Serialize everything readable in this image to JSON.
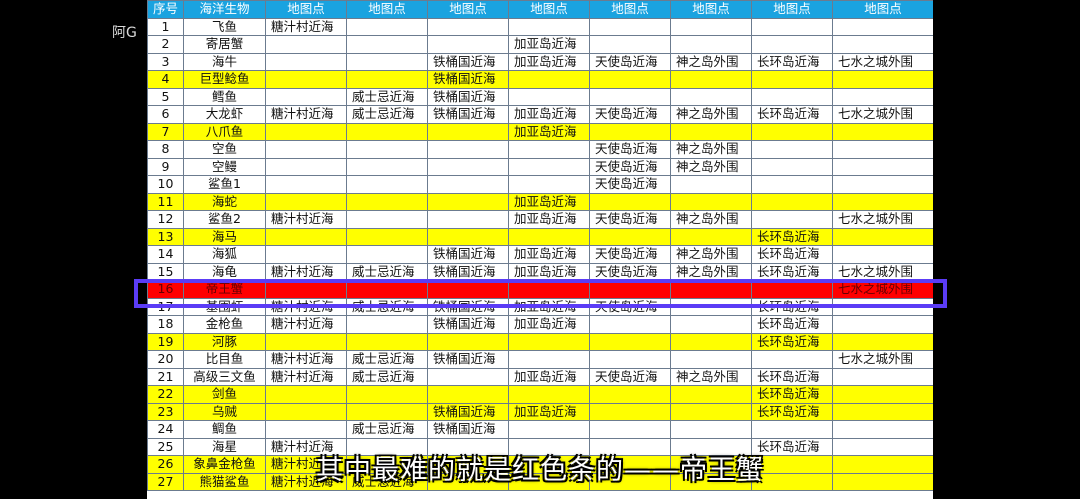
{
  "watermark": "阿G",
  "subtitle": "其中最难的就是红色条的——帝王蟹",
  "headers": [
    "序号",
    "海洋生物",
    "地图点",
    "地图点",
    "地图点",
    "地图点",
    "地图点",
    "地图点",
    "地图点",
    "地图点"
  ],
  "rows": [
    {
      "style": "white",
      "cells": [
        "1",
        "飞鱼",
        "糖汁村近海",
        "",
        "",
        "",
        "",
        "",
        "",
        ""
      ]
    },
    {
      "style": "white",
      "cells": [
        "2",
        "寄居蟹",
        "",
        "",
        "",
        "加亚岛近海",
        "",
        "",
        "",
        ""
      ]
    },
    {
      "style": "white",
      "cells": [
        "3",
        "海牛",
        "",
        "",
        "铁桶国近海",
        "加亚岛近海",
        "天使岛近海",
        "神之岛外围",
        "长环岛近海",
        "七水之城外围"
      ]
    },
    {
      "style": "yellow",
      "cells": [
        "4",
        "巨型鲶鱼",
        "",
        "",
        "铁桶国近海",
        "",
        "",
        "",
        "",
        ""
      ]
    },
    {
      "style": "white",
      "cells": [
        "5",
        "鳕鱼",
        "",
        "威士忌近海",
        "铁桶国近海",
        "",
        "",
        "",
        "",
        ""
      ]
    },
    {
      "style": "white",
      "cells": [
        "6",
        "大龙虾",
        "糖汁村近海",
        "威士忌近海",
        "铁桶国近海",
        "加亚岛近海",
        "天使岛近海",
        "神之岛外围",
        "长环岛近海",
        "七水之城外围"
      ]
    },
    {
      "style": "yellow",
      "cells": [
        "7",
        "八爪鱼",
        "",
        "",
        "",
        "加亚岛近海",
        "",
        "",
        "",
        ""
      ]
    },
    {
      "style": "white",
      "cells": [
        "8",
        "空鱼",
        "",
        "",
        "",
        "",
        "天使岛近海",
        "神之岛外围",
        "",
        ""
      ]
    },
    {
      "style": "white",
      "cells": [
        "9",
        "空鳗",
        "",
        "",
        "",
        "",
        "天使岛近海",
        "神之岛外围",
        "",
        ""
      ]
    },
    {
      "style": "white",
      "cells": [
        "10",
        "鲨鱼1",
        "",
        "",
        "",
        "",
        "天使岛近海",
        "",
        "",
        ""
      ]
    },
    {
      "style": "yellow",
      "cells": [
        "11",
        "海蛇",
        "",
        "",
        "",
        "加亚岛近海",
        "",
        "",
        "",
        ""
      ]
    },
    {
      "style": "white",
      "cells": [
        "12",
        "鲨鱼2",
        "糖汁村近海",
        "",
        "",
        "加亚岛近海",
        "天使岛近海",
        "神之岛外围",
        "",
        "七水之城外围"
      ]
    },
    {
      "style": "yellow",
      "cells": [
        "13",
        "海马",
        "",
        "",
        "",
        "",
        "",
        "",
        "长环岛近海",
        ""
      ]
    },
    {
      "style": "white",
      "cells": [
        "14",
        "海狐",
        "",
        "",
        "铁桶国近海",
        "加亚岛近海",
        "天使岛近海",
        "神之岛外围",
        "长环岛近海",
        ""
      ]
    },
    {
      "style": "white",
      "cells": [
        "15",
        "海龟",
        "糖汁村近海",
        "威士忌近海",
        "铁桶国近海",
        "加亚岛近海",
        "天使岛近海",
        "神之岛外围",
        "长环岛近海",
        "七水之城外围"
      ]
    },
    {
      "style": "red",
      "cells": [
        "16",
        "帝王蟹",
        "",
        "",
        "",
        "",
        "",
        "",
        "",
        "七水之城外围"
      ]
    },
    {
      "style": "white",
      "cells": [
        "17",
        "基围虾",
        "糖汁村近海",
        "威士忌近海",
        "铁桶国近海",
        "加亚岛近海",
        "天使岛近海",
        "",
        "长环岛近海",
        ""
      ]
    },
    {
      "style": "white",
      "cells": [
        "18",
        "金枪鱼",
        "糖汁村近海",
        "",
        "铁桶国近海",
        "加亚岛近海",
        "",
        "",
        "长环岛近海",
        ""
      ]
    },
    {
      "style": "yellow",
      "cells": [
        "19",
        "河豚",
        "",
        "",
        "",
        "",
        "",
        "",
        "长环岛近海",
        ""
      ]
    },
    {
      "style": "white",
      "cells": [
        "20",
        "比目鱼",
        "糖汁村近海",
        "威士忌近海",
        "铁桶国近海",
        "",
        "",
        "",
        "",
        "七水之城外围"
      ]
    },
    {
      "style": "white",
      "cells": [
        "21",
        "高级三文鱼",
        "糖汁村近海",
        "威士忌近海",
        "",
        "加亚岛近海",
        "天使岛近海",
        "神之岛外围",
        "长环岛近海",
        ""
      ]
    },
    {
      "style": "yellow",
      "cells": [
        "22",
        "剑鱼",
        "",
        "",
        "",
        "",
        "",
        "",
        "长环岛近海",
        ""
      ]
    },
    {
      "style": "yellow",
      "cells": [
        "23",
        "乌贼",
        "",
        "",
        "铁桶国近海",
        "加亚岛近海",
        "",
        "",
        "长环岛近海",
        ""
      ]
    },
    {
      "style": "white",
      "cells": [
        "24",
        "鲷鱼",
        "",
        "威士忌近海",
        "铁桶国近海",
        "",
        "",
        "",
        "",
        ""
      ]
    },
    {
      "style": "white",
      "cells": [
        "25",
        "海星",
        "糖汁村近海",
        "",
        "",
        "",
        "",
        "",
        "长环岛近海",
        ""
      ]
    },
    {
      "style": "yellow",
      "cells": [
        "26",
        "象鼻金枪鱼",
        "糖汁村近海",
        "",
        "",
        "",
        "",
        "",
        "",
        ""
      ]
    },
    {
      "style": "yellow",
      "cells": [
        "27",
        "熊猫鲨鱼",
        "糖汁村近海",
        "威士忌近海",
        "",
        "",
        "",
        "",
        "",
        ""
      ]
    }
  ]
}
